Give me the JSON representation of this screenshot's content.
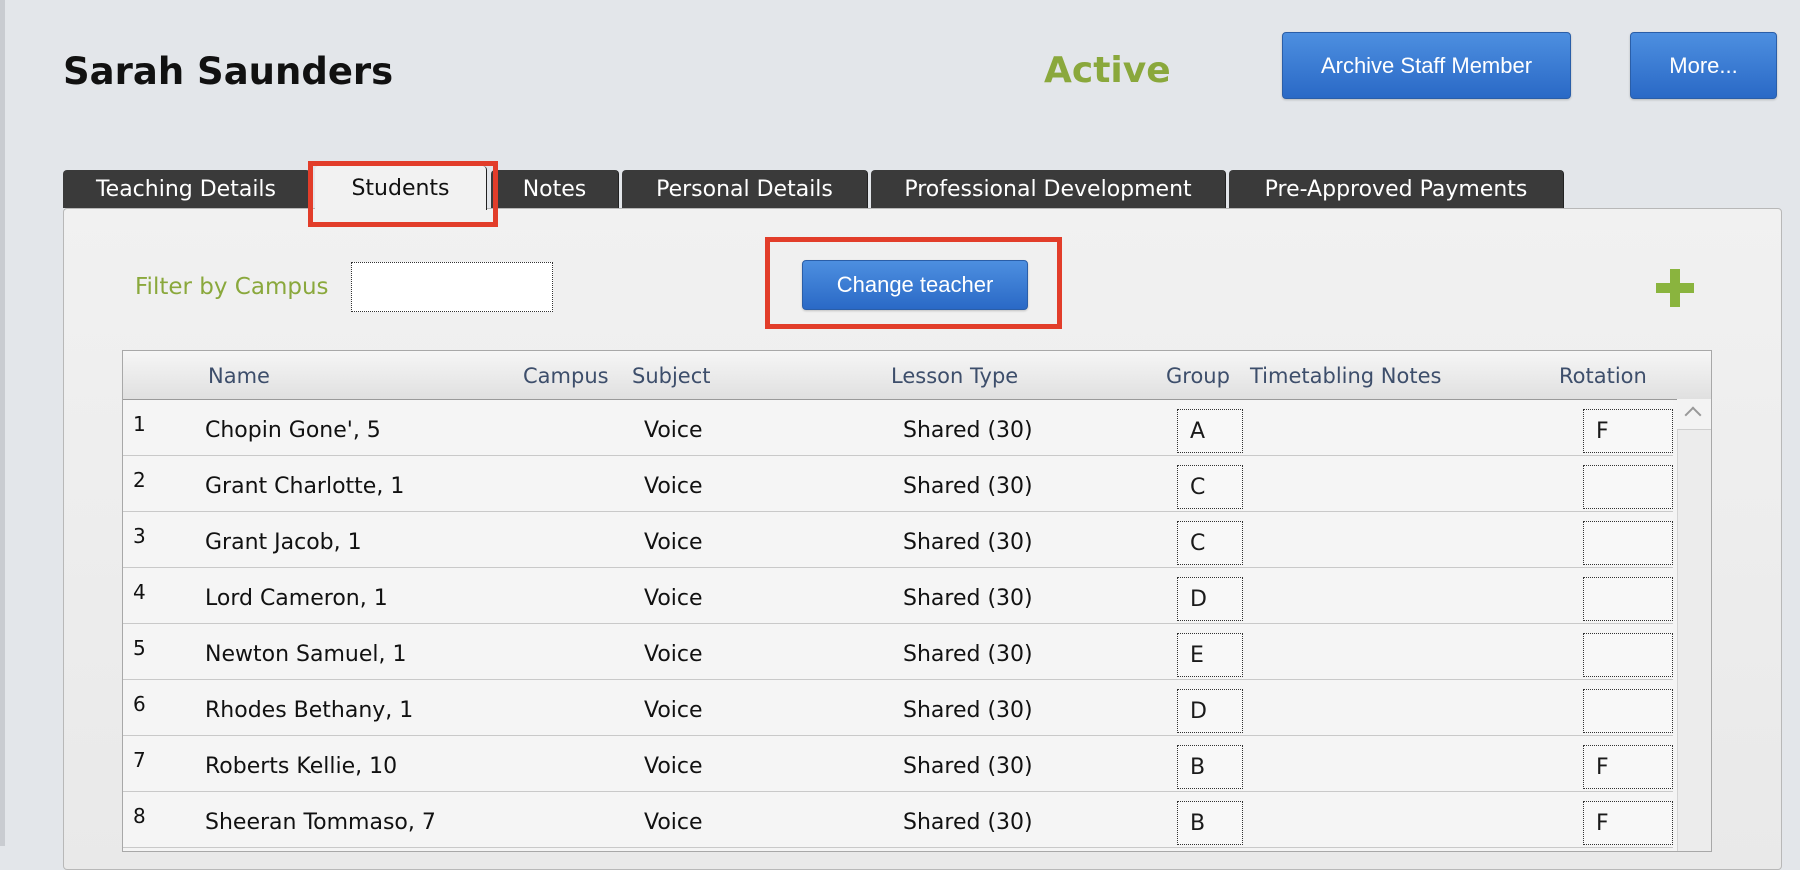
{
  "header": {
    "staff_name": "Sarah Saunders",
    "status": "Active",
    "archive_label": "Archive Staff Member",
    "more_label": "More..."
  },
  "tabs": [
    {
      "label": "Teaching Details"
    },
    {
      "label": "Students"
    },
    {
      "label": "Notes"
    },
    {
      "label": "Personal Details"
    },
    {
      "label": "Professional Development"
    },
    {
      "label": "Pre-Approved Payments"
    }
  ],
  "active_tab": "Students",
  "toolbar": {
    "filter_label": "Filter by Campus",
    "filter_value": "",
    "change_teacher_label": "Change teacher"
  },
  "table": {
    "headers": {
      "name": "Name",
      "campus": "Campus",
      "subject": "Subject",
      "lesson_type": "Lesson Type",
      "group": "Group",
      "timetabling_notes": "Timetabling Notes",
      "rotation": "Rotation"
    },
    "rows": [
      {
        "num": "1",
        "name": "Chopin Gone', 5",
        "campus": "",
        "subject": "Voice",
        "lesson_type": "Shared (30)",
        "group": "A",
        "notes": "",
        "rotation": "F"
      },
      {
        "num": "2",
        "name": "Grant Charlotte, 1",
        "campus": "",
        "subject": "Voice",
        "lesson_type": "Shared (30)",
        "group": "C",
        "notes": "",
        "rotation": ""
      },
      {
        "num": "3",
        "name": "Grant Jacob, 1",
        "campus": "",
        "subject": "Voice",
        "lesson_type": "Shared (30)",
        "group": "C",
        "notes": "",
        "rotation": ""
      },
      {
        "num": "4",
        "name": "Lord Cameron, 1",
        "campus": "",
        "subject": "Voice",
        "lesson_type": "Shared (30)",
        "group": "D",
        "notes": "",
        "rotation": ""
      },
      {
        "num": "5",
        "name": "Newton Samuel, 1",
        "campus": "",
        "subject": "Voice",
        "lesson_type": "Shared (30)",
        "group": "E",
        "notes": "",
        "rotation": ""
      },
      {
        "num": "6",
        "name": "Rhodes Bethany, 1",
        "campus": "",
        "subject": "Voice",
        "lesson_type": "Shared (30)",
        "group": "D",
        "notes": "",
        "rotation": ""
      },
      {
        "num": "7",
        "name": "Roberts Kellie, 10",
        "campus": "",
        "subject": "Voice",
        "lesson_type": "Shared (30)",
        "group": "B",
        "notes": "",
        "rotation": "F"
      },
      {
        "num": "8",
        "name": "Sheeran Tommaso, 7",
        "campus": "",
        "subject": "Voice",
        "lesson_type": "Shared (30)",
        "group": "B",
        "notes": "",
        "rotation": "F"
      }
    ]
  },
  "colors": {
    "accent_green": "#8aa83c",
    "button_blue": "#2a69c6",
    "highlight_red": "#e23d2a",
    "tab_dark": "#3a3a3a"
  },
  "icons": {
    "add": "plus-icon",
    "scroll_up": "chevron-up-icon"
  }
}
